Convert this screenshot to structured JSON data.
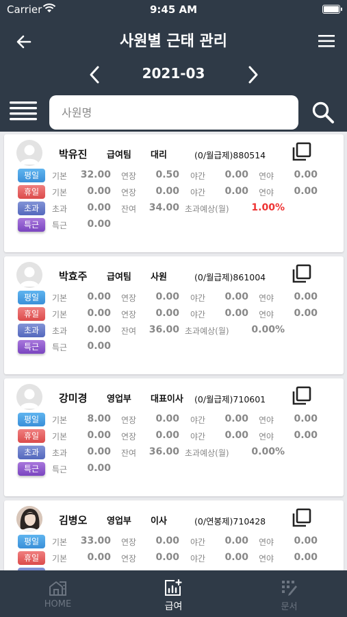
{
  "status_bar": {
    "carrier": "Carrier",
    "time": "9:45 AM"
  },
  "header": {
    "title": "사원별 근태 관리",
    "month": "2021-03",
    "search_placeholder": "사원명"
  },
  "employees": [
    {
      "name": "박유진",
      "department": "급여팀",
      "position": "대리",
      "pay_info": "(0/월급제)880514",
      "has_photo": false,
      "row1": {
        "badge": "평일",
        "l1": "기본",
        "v1": "32.00",
        "l2": "연장",
        "v2": "0.50",
        "l3": "야간",
        "v3": "0.00",
        "l4": "연야",
        "v4": "0.00"
      },
      "row2": {
        "badge": "휴일",
        "l1": "기본",
        "v1": "0.00",
        "l2": "연장",
        "v2": "0.00",
        "l3": "야간",
        "v3": "0.00",
        "l4": "연야",
        "v4": "0.00"
      },
      "row3": {
        "badge": "초과",
        "l1": "초과",
        "v1": "0.00",
        "l2": "잔여",
        "v2": "34.00",
        "l3": "초과예상(월)",
        "v3": "1.00%"
      },
      "row4": {
        "badge": "특근",
        "l1": "특근",
        "v1": "0.00"
      }
    },
    {
      "name": "박효주",
      "department": "급여팀",
      "position": "사원",
      "pay_info": "(0/월급제)861004",
      "has_photo": false,
      "row1": {
        "badge": "평일",
        "l1": "기본",
        "v1": "0.00",
        "l2": "연장",
        "v2": "0.00",
        "l3": "야간",
        "v3": "0.00",
        "l4": "연야",
        "v4": "0.00"
      },
      "row2": {
        "badge": "휴일",
        "l1": "기본",
        "v1": "0.00",
        "l2": "연장",
        "v2": "0.00",
        "l3": "야간",
        "v3": "0.00",
        "l4": "연야",
        "v4": "0.00"
      },
      "row3": {
        "badge": "초과",
        "l1": "초과",
        "v1": "0.00",
        "l2": "잔여",
        "v2": "36.00",
        "l3": "초과예상(월)",
        "v3": "0.00%"
      },
      "row4": {
        "badge": "특근",
        "l1": "특근",
        "v1": "0.00"
      }
    },
    {
      "name": "강미경",
      "department": "영업부",
      "position": "대표이사",
      "pay_info": "(0/월급제)710601",
      "has_photo": false,
      "row1": {
        "badge": "평일",
        "l1": "기본",
        "v1": "8.00",
        "l2": "연장",
        "v2": "0.00",
        "l3": "야간",
        "v3": "0.00",
        "l4": "연야",
        "v4": "0.00"
      },
      "row2": {
        "badge": "휴일",
        "l1": "기본",
        "v1": "0.00",
        "l2": "연장",
        "v2": "0.00",
        "l3": "야간",
        "v3": "0.00",
        "l4": "연야",
        "v4": "0.00"
      },
      "row3": {
        "badge": "초과",
        "l1": "초과",
        "v1": "0.00",
        "l2": "잔여",
        "v2": "36.00",
        "l3": "초과예상(월)",
        "v3": "0.00%"
      },
      "row4": {
        "badge": "특근",
        "l1": "특근",
        "v1": "0.00"
      }
    },
    {
      "name": "김병오",
      "department": "영업부",
      "position": "이사",
      "pay_info": "(0/연봉제)710428",
      "has_photo": true,
      "row1": {
        "badge": "평일",
        "l1": "기본",
        "v1": "33.00",
        "l2": "연장",
        "v2": "0.00",
        "l3": "야간",
        "v3": "0.00",
        "l4": "연야",
        "v4": "0.00"
      },
      "row2": {
        "badge": "휴일",
        "l1": "기본",
        "v1": "0.00",
        "l2": "연장",
        "v2": "0.00",
        "l3": "야간",
        "v3": "0.00",
        "l4": "연야",
        "v4": "0.00"
      }
    }
  ],
  "tabs": [
    {
      "label": "HOME",
      "icon": "home-icon",
      "active": false
    },
    {
      "label": "급여",
      "icon": "payroll-icon",
      "active": true
    },
    {
      "label": "문서",
      "icon": "document-icon",
      "active": false
    }
  ],
  "colors": {
    "navy": "#2f3a47",
    "weekday": "#3a8fd8",
    "holiday": "#dc4b4b",
    "overtime": "#5468bd",
    "special": "#7a45c0",
    "alert": "#e33333"
  }
}
